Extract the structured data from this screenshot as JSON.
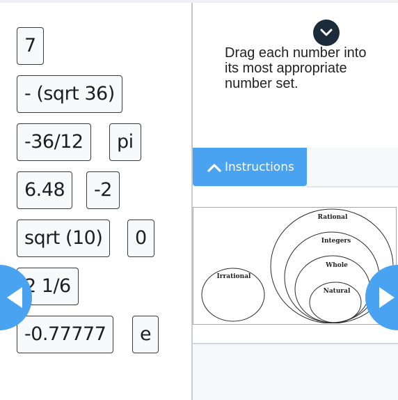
{
  "number_tiles": [
    {
      "id": "tile-7",
      "label": "7"
    },
    {
      "id": "tile-neg-sqrt-36",
      "label": "- (sqrt 36)"
    },
    {
      "id": "tile-neg-36-12",
      "label": "-36/12"
    },
    {
      "id": "tile-pi",
      "label": "pi"
    },
    {
      "id": "tile-6-48",
      "label": "6.48"
    },
    {
      "id": "tile-neg-2",
      "label": "-2"
    },
    {
      "id": "tile-sqrt-10",
      "label": "sqrt (10)"
    },
    {
      "id": "tile-0",
      "label": "0"
    },
    {
      "id": "tile-2-1-6",
      "label": "2 1/6"
    },
    {
      "id": "tile-neg-0-77777",
      "label": "-0.77777"
    },
    {
      "id": "tile-e",
      "label": "e"
    }
  ],
  "instructions": {
    "text": "Drag each number into its most appropriate number set.",
    "tab_label": "Instructions",
    "tab_icon": "chevron-up-icon",
    "collapse_icon": "chevron-down-icon"
  },
  "diagram": {
    "sets": [
      {
        "name": "irrational",
        "label": "Irrational"
      },
      {
        "name": "rational",
        "label": "Rational"
      },
      {
        "name": "integers",
        "label": "Integers"
      },
      {
        "name": "whole",
        "label": "Whole"
      },
      {
        "name": "natural",
        "label": "Natural"
      }
    ]
  },
  "navigation": {
    "prev_icon": "triangle-left-icon",
    "next_icon": "triangle-right-icon"
  },
  "colors": {
    "accent": "#4aa3f0",
    "collapse_button": "#1b2b3a",
    "tile_border": "#3a3a3a",
    "tile_background": "#f8f9fa"
  }
}
